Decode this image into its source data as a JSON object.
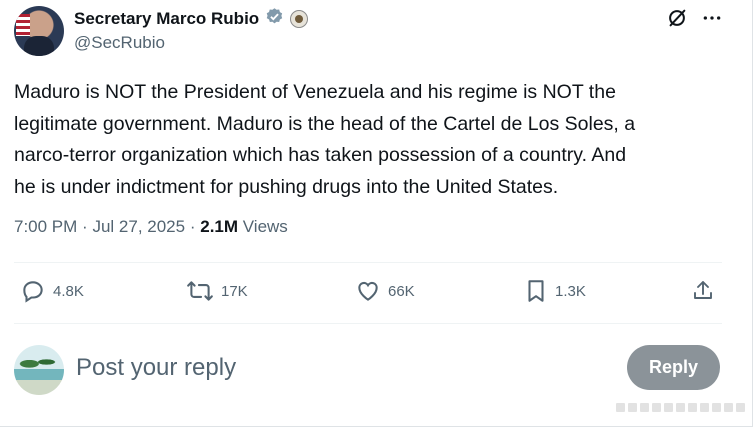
{
  "author": {
    "display_name": "Secretary Marco Rubio",
    "handle": "@SecRubio",
    "verified_badge_icon": "verified-badge-icon",
    "affiliation_icon": "state-department-seal-icon",
    "badge_color": "#829aab"
  },
  "tweet": {
    "lines": [
      "Maduro is NOT the President of Venezuela and his regime is NOT the",
      "legitimate government.  Maduro is the head of the Cartel de Los Soles, a",
      "narco-terror organization which has taken possession of a country.  And",
      "he is under indictment for pushing drugs into the United States."
    ],
    "time": "7:00 PM",
    "date": "Jul 27, 2025",
    "separator": "·",
    "views_count": "2.1M",
    "views_label": "Views"
  },
  "actions": {
    "replies": "4.8K",
    "reposts": "17K",
    "likes": "66K",
    "bookmarks": "1.3K"
  },
  "reply_box": {
    "placeholder": "Post your reply",
    "button_label": "Reply"
  },
  "colors": {
    "text": "#0f1419",
    "muted": "#536471",
    "reply_button": "#8b9399",
    "divider": "#eff3f4"
  }
}
